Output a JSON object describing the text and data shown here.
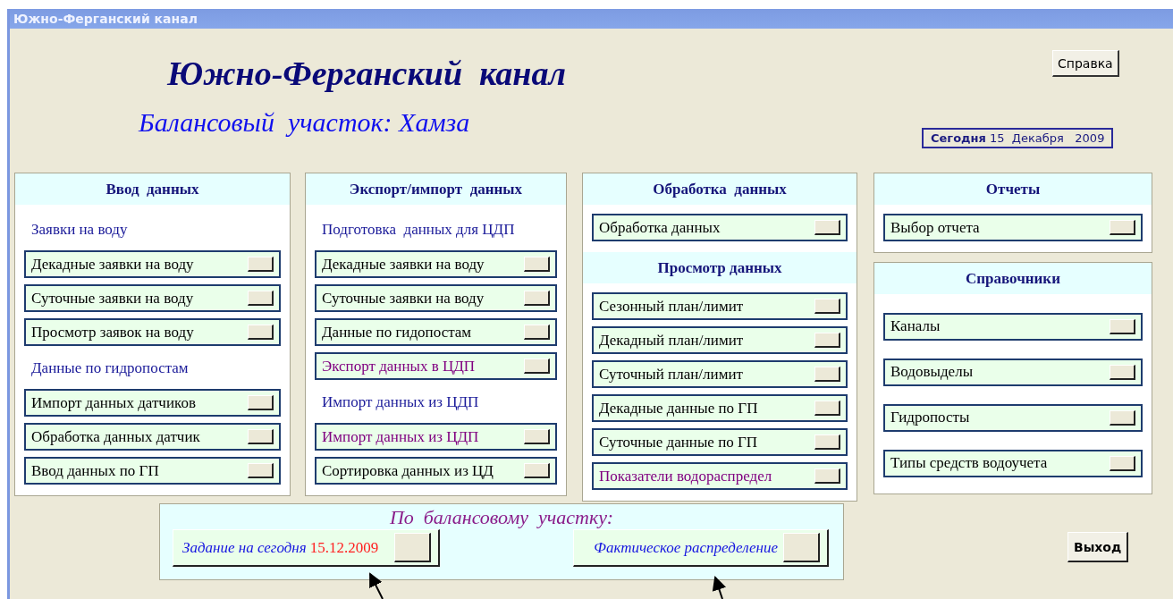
{
  "window": {
    "title": "Южно-Ферганский канал"
  },
  "header": {
    "title": "Южно-Ферганский  канал",
    "subtitle": "Балансовый  участок: Хамза",
    "help_button": "Справка",
    "date": "**Сегодня** 15  Декабря   2009"
  },
  "columns": [
    {
      "panels": [
        {
          "sections": [
            {
              "heading": "Ввод  данных",
              "items": [
                {
                  "kind": "subheading",
                  "label": "Заявки на воду"
                },
                {
                  "kind": "button",
                  "label": "Декадные заявки на воду",
                  "color": "#000000"
                },
                {
                  "kind": "button",
                  "label": "Суточные заявки на воду",
                  "color": "#000000"
                },
                {
                  "kind": "button",
                  "label": "Просмотр заявок на воду",
                  "color": "#000000"
                },
                {
                  "kind": "subheading",
                  "label": "Данные по гидропостам"
                },
                {
                  "kind": "button",
                  "label": "Импорт данных датчиков",
                  "color": "#000000"
                },
                {
                  "kind": "button",
                  "label": "Обработка данных датчик",
                  "color": "#000000"
                },
                {
                  "kind": "button",
                  "label": "Ввод данных по ГП",
                  "color": "#000000"
                }
              ]
            }
          ]
        }
      ]
    },
    {
      "panels": [
        {
          "sections": [
            {
              "heading": "Экспорт/импорт  данных",
              "items": [
                {
                  "kind": "subheading",
                  "label": "Подготовка  данных для ЦДП"
                },
                {
                  "kind": "button",
                  "label": "Декадные заявки на воду",
                  "color": "#000000"
                },
                {
                  "kind": "button",
                  "label": "Суточные заявки на воду",
                  "color": "#000000"
                },
                {
                  "kind": "button",
                  "label": "Данные по гидопостам",
                  "color": "#000000"
                },
                {
                  "kind": "button",
                  "label": "Экспорт данных в ЦДП",
                  "color": "#800080"
                },
                {
                  "kind": "subheading",
                  "label": "Импорт данных из ЦДП"
                },
                {
                  "kind": "button",
                  "label": "Импорт данных из ЦДП",
                  "color": "#800080"
                },
                {
                  "kind": "button",
                  "label": "Сортировка данных из ЦД",
                  "color": "#000000"
                }
              ]
            }
          ]
        }
      ]
    },
    {
      "panels": [
        {
          "sections": [
            {
              "heading": "Обработка  данных",
              "items": [
                {
                  "kind": "button",
                  "label": "Обработка данных",
                  "color": "#000000"
                }
              ]
            },
            {
              "heading": "Просмотр данных",
              "items": [
                {
                  "kind": "button",
                  "label": "Сезонный план/лимит",
                  "color": "#000000"
                },
                {
                  "kind": "button",
                  "label": "Декадный план/лимит",
                  "color": "#000000"
                },
                {
                  "kind": "button",
                  "label": "Суточный план/лимит",
                  "color": "#000000"
                },
                {
                  "kind": "button",
                  "label": "Декадные данные по ГП",
                  "color": "#000000"
                },
                {
                  "kind": "button",
                  "label": "Суточные данные по ГП",
                  "color": "#000000"
                },
                {
                  "kind": "button",
                  "label": "Показатели водораспредел",
                  "color": "#800080"
                }
              ]
            }
          ]
        }
      ]
    },
    {
      "panels": [
        {
          "sections": [
            {
              "heading": "Отчеты",
              "items": [
                {
                  "kind": "button",
                  "label": "Выбор отчета",
                  "color": "#000000"
                }
              ]
            }
          ]
        },
        {
          "sections": [
            {
              "heading": "Справочники",
              "items": [
                {
                  "kind": "button",
                  "label": "Каналы",
                  "color": "#000000"
                },
                {
                  "kind": "button",
                  "label": "Водовыделы",
                  "color": "#000000"
                },
                {
                  "kind": "button",
                  "label": "Гидропосты",
                  "color": "#000000"
                },
                {
                  "kind": "button",
                  "label": "Типы средств водоучета",
                  "color": "#000000"
                }
              ]
            }
          ]
        }
      ]
    }
  ],
  "balance_panel": {
    "heading": "По  балансовому  участку:",
    "task_button": {
      "label": "Задание на сегодня",
      "date": "15.12.2009"
    },
    "actual_button": {
      "label": "Фактическое распределение"
    }
  },
  "exit_button": "Выход"
}
